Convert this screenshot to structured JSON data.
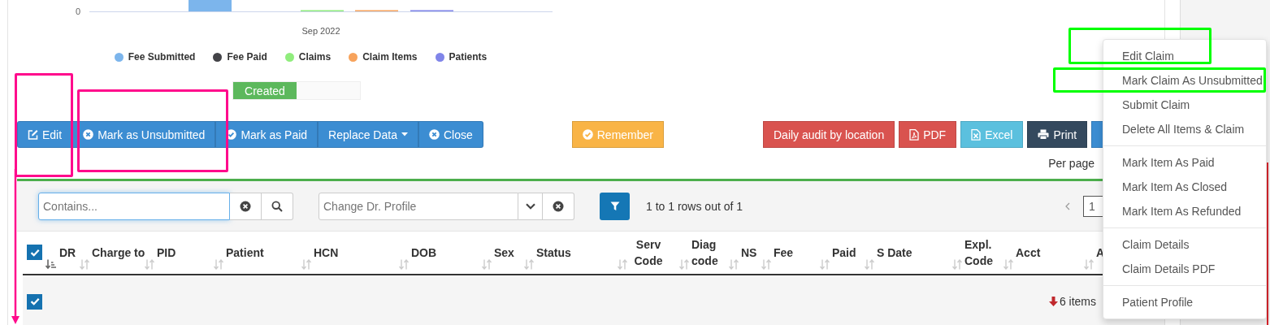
{
  "chart": {
    "y_tick": "0",
    "category": "Sep 2022",
    "legend": [
      {
        "label": "Fee Submitted",
        "color": "#7cb5ec"
      },
      {
        "label": "Fee Paid",
        "color": "#434348"
      },
      {
        "label": "Claims",
        "color": "#90ed7d"
      },
      {
        "label": "Claim Items",
        "color": "#f7a35c"
      },
      {
        "label": "Patients",
        "color": "#8085e9"
      }
    ]
  },
  "status_bar": {
    "label": "Created",
    "level": 0.5
  },
  "toolbar": {
    "left": [
      {
        "label": "Edit",
        "kind": "edit"
      },
      {
        "label": "Mark as Unsubmitted",
        "kind": "unsubmit"
      },
      {
        "label": "Mark as Paid",
        "kind": "paid"
      },
      {
        "label": "Replace Data",
        "kind": "dropdown"
      },
      {
        "label": "Close",
        "kind": "close"
      }
    ],
    "middle": [
      {
        "label": "Remember",
        "kind": "remember"
      }
    ],
    "right": [
      {
        "label": "Daily audit by location",
        "kind": "audit"
      },
      {
        "label": "PDF",
        "kind": "pdf"
      },
      {
        "label": "Excel",
        "kind": "excel"
      },
      {
        "label": "Print",
        "kind": "print"
      },
      {
        "kind": "more"
      }
    ]
  },
  "per_page": "Per page",
  "filters": {
    "search": {
      "placeholder": "Contains..."
    },
    "profile": {
      "placeholder": "Change Dr. Profile"
    },
    "rows_info": "1 to 1 rows out of 1",
    "page": "1"
  },
  "table": {
    "columns": [
      {
        "kind": "checkbox",
        "checked": true,
        "sorted": true
      },
      {
        "label": "DR",
        "sorted": false
      },
      {
        "label": "Charge to",
        "sorted": false
      },
      {
        "label": "PID",
        "sorted": false
      },
      {
        "label": "Patient",
        "sorted": false
      },
      {
        "label": "HCN",
        "sorted": false
      },
      {
        "label": "DOB",
        "sorted": false
      },
      {
        "label": "Sex",
        "sorted": false
      },
      {
        "label": "Status",
        "sorted": false
      },
      {
        "label": "Serv Code",
        "sorted": false
      },
      {
        "label": "Diag code",
        "sorted": false
      },
      {
        "label": "NS",
        "sorted": false
      },
      {
        "label": "Fee",
        "sorted": false
      },
      {
        "label": "Paid",
        "sorted": false
      },
      {
        "label": "S Date",
        "sorted": false
      },
      {
        "label": "Expl. Code",
        "sorted": false
      },
      {
        "label": "Acct",
        "sorted": false
      },
      {
        "label": "A"
      }
    ],
    "rows": [
      {
        "checked": true,
        "summary": "6 items"
      }
    ]
  },
  "menu": {
    "groups": [
      [
        {
          "label": "Edit Claim"
        },
        {
          "label": "Mark Claim As Unsubmitted"
        },
        {
          "label": "Submit Claim"
        },
        {
          "label": "Delete All Items & Claim"
        }
      ],
      [
        {
          "label": "Mark Item As Paid"
        },
        {
          "label": "Mark Item As Closed"
        },
        {
          "label": "Mark Item As Refunded"
        }
      ],
      [
        {
          "label": "Claim Details"
        },
        {
          "label": "Claim Details PDF"
        }
      ],
      [
        {
          "label": "Patient Profile"
        }
      ]
    ]
  },
  "annotations": [
    {
      "kind": "box",
      "color": "#ff0a8c"
    },
    {
      "kind": "box",
      "color": "#ff0a8c"
    },
    {
      "kind": "arrow",
      "color": "#ff0a8c"
    },
    {
      "kind": "box",
      "color": "#00ff00"
    },
    {
      "kind": "box",
      "color": "#00ff00"
    }
  ]
}
